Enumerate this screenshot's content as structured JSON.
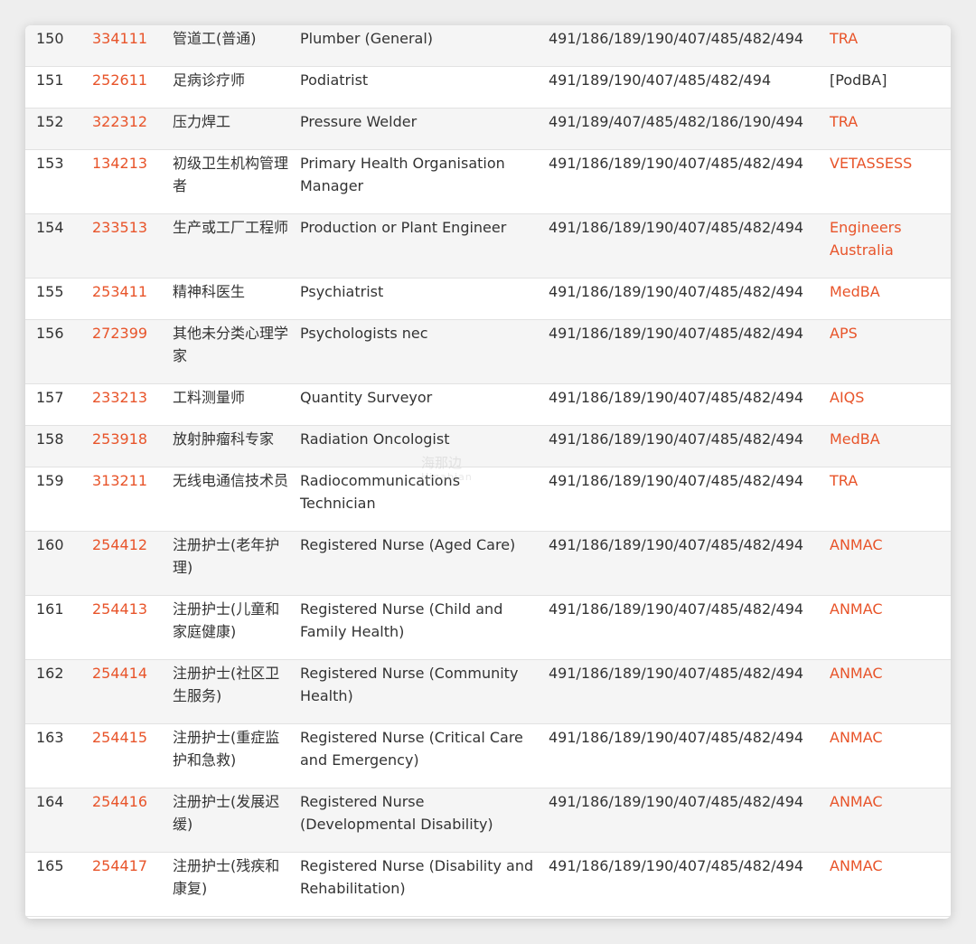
{
  "rows": [
    {
      "no": "150",
      "code": "334111",
      "cn": "管道工(普通)",
      "en": "Plumber (General)",
      "visas": "491/186/189/190/407/485/482/494",
      "authority": "TRA"
    },
    {
      "no": "151",
      "code": "252611",
      "cn": "足病诊疗师",
      "en": "Podiatrist",
      "visas": "491/189/190/407/485/482/494",
      "authority": "[PodBA]"
    },
    {
      "no": "152",
      "code": "322312",
      "cn": "压力焊工",
      "en": "Pressure Welder",
      "visas": "491/189/407/485/482/186/190/494",
      "authority": "TRA"
    },
    {
      "no": "153",
      "code": "134213",
      "cn": "初级卫生机构管理者",
      "en": "Primary Health Organisation Manager",
      "visas": "491/186/189/190/407/485/482/494",
      "authority": "VETASSESS"
    },
    {
      "no": "154",
      "code": "233513",
      "cn": "生产或工厂工程师",
      "en": "Production or Plant Engineer",
      "visas": "491/186/189/190/407/485/482/494",
      "authority": "Engineers Australia"
    },
    {
      "no": "155",
      "code": "253411",
      "cn": "精神科医生",
      "en": "Psychiatrist",
      "visas": "491/186/189/190/407/485/482/494",
      "authority": "MedBA"
    },
    {
      "no": "156",
      "code": "272399",
      "cn": "其他未分类心理学家",
      "en": "Psychologists nec",
      "visas": "491/186/189/190/407/485/482/494",
      "authority": "APS"
    },
    {
      "no": "157",
      "code": "233213",
      "cn": "工料测量师",
      "en": "Quantity Surveyor",
      "visas": "491/186/189/190/407/485/482/494",
      "authority": "AIQS"
    },
    {
      "no": "158",
      "code": "253918",
      "cn": "放射肿瘤科专家",
      "en": "Radiation Oncologist",
      "visas": "491/186/189/190/407/485/482/494",
      "authority": "MedBA"
    },
    {
      "no": "159",
      "code": "313211",
      "cn": "无线电通信技术员",
      "en": "Radiocommunications Technician",
      "visas": "491/186/189/190/407/485/482/494",
      "authority": "TRA"
    },
    {
      "no": "160",
      "code": "254412",
      "cn": "注册护士(老年护理)",
      "en": "Registered Nurse (Aged Care)",
      "visas": "491/186/189/190/407/485/482/494",
      "authority": "ANMAC"
    },
    {
      "no": "161",
      "code": "254413",
      "cn": "注册护士(儿童和家庭健康)",
      "en": "Registered Nurse (Child and Family Health)",
      "visas": "491/186/189/190/407/485/482/494",
      "authority": "ANMAC"
    },
    {
      "no": "162",
      "code": "254414",
      "cn": "注册护士(社区卫生服务)",
      "en": "Registered Nurse (Community Health)",
      "visas": "491/186/189/190/407/485/482/494",
      "authority": "ANMAC"
    },
    {
      "no": "163",
      "code": "254415",
      "cn": "注册护士(重症监护和急救)",
      "en": "Registered Nurse (Critical Care and Emergency)",
      "visas": "491/186/189/190/407/485/482/494",
      "authority": "ANMAC"
    },
    {
      "no": "164",
      "code": "254416",
      "cn": "注册护士(发展迟缓)",
      "en": "Registered Nurse (Developmental Disability)",
      "visas": "491/186/189/190/407/485/482/494",
      "authority": "ANMAC"
    },
    {
      "no": "165",
      "code": "254417",
      "cn": "注册护士(残疾和康复)",
      "en": "Registered Nurse (Disability and Rehabilitation)",
      "visas": "491/186/189/190/407/485/482/494",
      "authority": "ANMAC"
    }
  ],
  "colors": {
    "link": "#e8542a",
    "text": "#333333",
    "row_alt": "#f5f5f5"
  },
  "watermark": {
    "main": "海那边",
    "sub": "Hinabian"
  }
}
